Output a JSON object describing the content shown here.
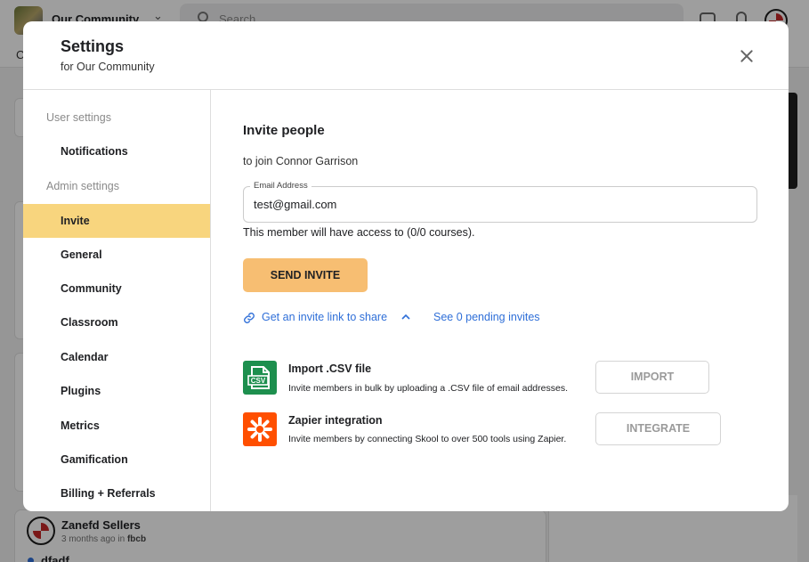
{
  "background": {
    "community_name": "Our Community",
    "search_placeholder": "Search",
    "tab_letter": "C",
    "post": {
      "author": "Zanefd Sellers",
      "time": "3 months ago in",
      "category": "fbcb",
      "title": "dfadf"
    }
  },
  "modal": {
    "title": "Settings",
    "subtitle": "for Our Community",
    "close_icon": "close-icon"
  },
  "sidebar": {
    "user_group_label": "User settings",
    "user_items": [
      {
        "label": "Notifications"
      }
    ],
    "admin_group_label": "Admin settings",
    "admin_items": [
      {
        "label": "Invite",
        "active": true
      },
      {
        "label": "General"
      },
      {
        "label": "Community"
      },
      {
        "label": "Classroom"
      },
      {
        "label": "Calendar"
      },
      {
        "label": "Plugins"
      },
      {
        "label": "Metrics"
      },
      {
        "label": "Gamification"
      },
      {
        "label": "Billing + Referrals"
      }
    ],
    "active_color": "#f8d57e"
  },
  "invite": {
    "title": "Invite people",
    "subtitle": "to join Connor Garrison",
    "email_label": "Email Address",
    "email_value": "test@gmail.com",
    "access_note": "This member will have access to (0/0 courses).",
    "send_button": "SEND INVITE",
    "send_button_color": "#f7be72",
    "invite_link_text": "Get an invite link to share",
    "invite_link_icon": "link-icon",
    "pending_invites_text": "See 0 pending invites",
    "link_color": "#2f6fd8"
  },
  "integrations": [
    {
      "icon": "csv-file-icon",
      "title": "Import .CSV file",
      "description": "Invite members in bulk by uploading a .CSV file of email addresses.",
      "button": "IMPORT",
      "icon_color": "#1d8f4e"
    },
    {
      "icon": "zapier-icon",
      "title": "Zapier integration",
      "description": "Invite members by connecting Skool to over 500 tools using Zapier.",
      "button": "INTEGRATE",
      "icon_color": "#ff4f00"
    }
  ]
}
